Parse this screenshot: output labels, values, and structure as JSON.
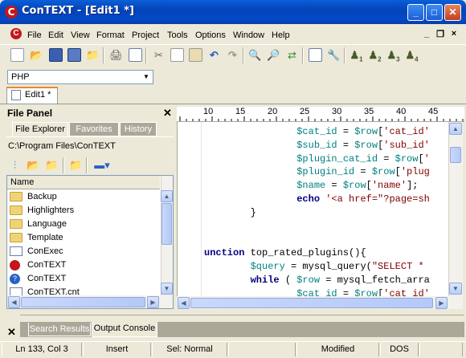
{
  "window": {
    "title": "ConTEXT - [Edit1 *]"
  },
  "menu": {
    "items": [
      "File",
      "Edit",
      "View",
      "Format",
      "Project",
      "Tools",
      "Options",
      "Window",
      "Help"
    ],
    "mdi_controls": [
      "_",
      "❐",
      "×"
    ]
  },
  "toolbar": {
    "icons": [
      "new-file-icon",
      "open-folder-icon",
      "save-icon",
      "save-all-icon",
      "open-file-icon",
      "print-icon",
      "print-preview-icon",
      "cut-icon",
      "copy-icon",
      "paste-icon",
      "undo-icon",
      "redo-icon",
      "find-icon",
      "find-next-icon",
      "replace-icon",
      "file-info-icon",
      "tools-icon",
      "user-command-1-icon",
      "user-command-2-icon",
      "user-command-3-icon",
      "user-command-4-icon"
    ],
    "user_cmd_labels": [
      "1",
      "2",
      "3",
      "4"
    ]
  },
  "highlighter": {
    "value": "PHP"
  },
  "document_tab": {
    "label": "Edit1 *"
  },
  "file_panel": {
    "title": "File Panel",
    "tabs": [
      "File Explorer",
      "Favorites",
      "History"
    ],
    "active_tab": "File Explorer",
    "path": "C:\\Program Files\\ConTEXT",
    "column_header": "Name",
    "files": [
      {
        "name": "Backup",
        "type": "folder"
      },
      {
        "name": "Highlighters",
        "type": "folder"
      },
      {
        "name": "Language",
        "type": "folder"
      },
      {
        "name": "Template",
        "type": "folder"
      },
      {
        "name": "ConExec",
        "type": "exe"
      },
      {
        "name": "ConTEXT",
        "type": "context"
      },
      {
        "name": "ConTEXT",
        "type": "help"
      },
      {
        "name": "ConTEXT.cnt",
        "type": "exe"
      }
    ]
  },
  "ruler": {
    "marks": [
      "10",
      "15",
      "20",
      "25",
      "30",
      "35",
      "40",
      "45"
    ]
  },
  "editor": {
    "lines": [
      "                $cat_id = $row['cat_id'",
      "                $sub_id = $row['sub_id'",
      "                $plugin_cat_id = $row['",
      "                $plugin_id = $row['plug",
      "                $name = $row['name'];",
      "                echo '<a href=\"?page=sh",
      "        }",
      "",
      "",
      "unction top_rated_plugins(){",
      "        $query = mysql_query(\"SELECT *",
      "        while ( $row = mysql_fetch_arra",
      "                $cat_id = $row['cat_id'"
    ]
  },
  "bottom_panel": {
    "tabs": [
      "Search Results",
      "Output Console"
    ],
    "active_tab": "Output Console"
  },
  "status": {
    "position": "Ln 133, Col 3",
    "mode": "Insert",
    "selection": "Sel: Normal",
    "modified": "Modified",
    "format": "DOS"
  },
  "colors": {
    "keyword": "#000080",
    "string": "#800000",
    "variable": "#008080",
    "tab_accent": "#e68b2c"
  }
}
